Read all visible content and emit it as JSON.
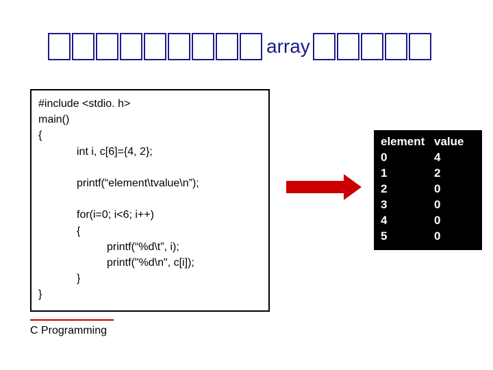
{
  "title": {
    "word": "array",
    "glyph_boxes_before": 9,
    "glyph_boxes_after": 5
  },
  "code": {
    "lines": [
      {
        "indent": 0,
        "text": "#include <stdio. h>"
      },
      {
        "indent": 0,
        "text": "main()"
      },
      {
        "indent": 0,
        "text": "{"
      },
      {
        "indent": 1,
        "text": "int i, c[6]={4, 2};"
      },
      {
        "indent": 1,
        "text": " "
      },
      {
        "indent": 1,
        "text": "printf(“element\\tvalue\\n”);"
      },
      {
        "indent": 1,
        "text": " "
      },
      {
        "indent": 1,
        "text": "for(i=0; i<6; i++)"
      },
      {
        "indent": 1,
        "text": "{"
      },
      {
        "indent": 2,
        "text": "printf(“%d\\t”, i);"
      },
      {
        "indent": 2,
        "text": "printf(\"%d\\n\", c[i]);"
      },
      {
        "indent": 1,
        "text": "}"
      },
      {
        "indent": 0,
        "text": "}"
      }
    ]
  },
  "output": {
    "header_left": "element",
    "header_right": "value",
    "rows": [
      {
        "idx": "0",
        "val": "4"
      },
      {
        "idx": "1",
        "val": "2"
      },
      {
        "idx": "2",
        "val": "0"
      },
      {
        "idx": "3",
        "val": "0"
      },
      {
        "idx": "4",
        "val": "0"
      },
      {
        "idx": "5",
        "val": "0"
      }
    ]
  },
  "footer": "C Programming",
  "chart_data": {
    "type": "table",
    "title": "Program output: element index vs stored value",
    "columns": [
      "element",
      "value"
    ],
    "rows": [
      [
        0,
        4
      ],
      [
        1,
        2
      ],
      [
        2,
        0
      ],
      [
        3,
        0
      ],
      [
        4,
        0
      ],
      [
        5,
        0
      ]
    ]
  }
}
